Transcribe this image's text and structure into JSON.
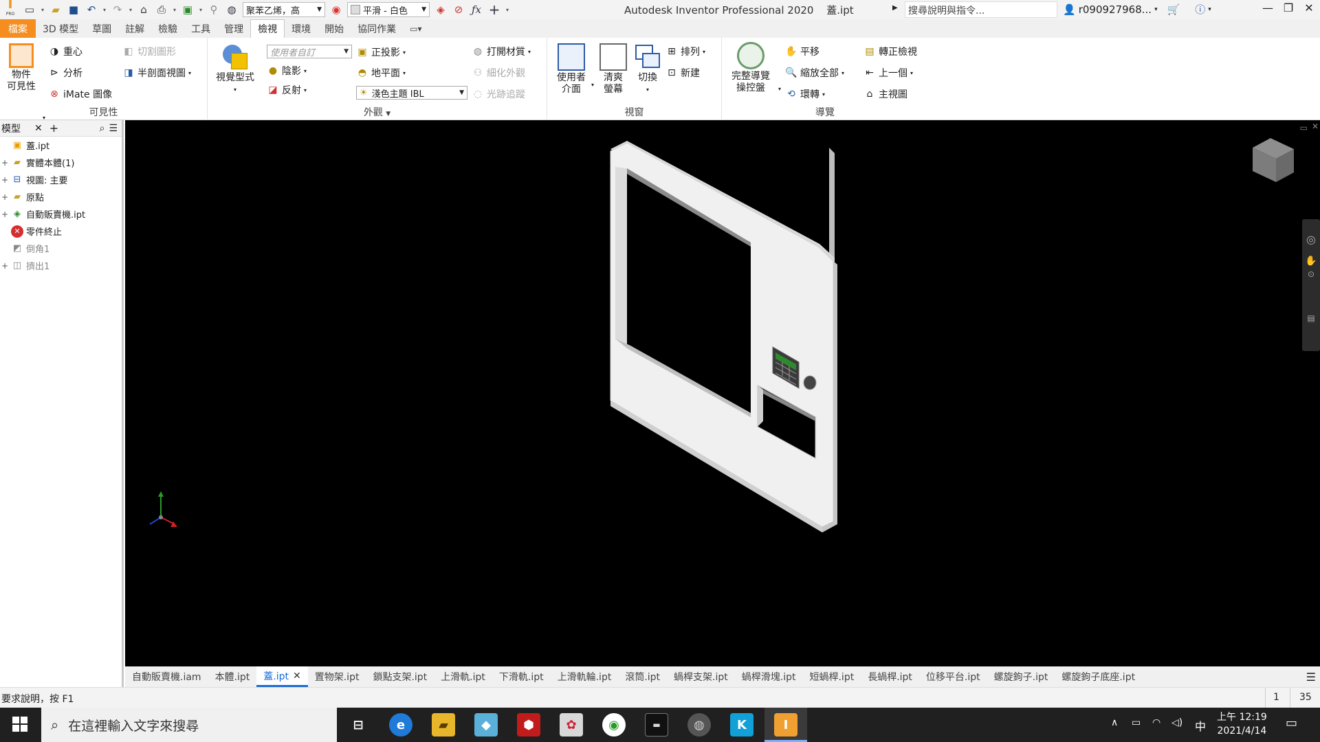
{
  "titlebar": {
    "app_title": "Autodesk Inventor Professional 2020",
    "doc_title": "蓋.ipt",
    "material_select": "聚苯乙烯，高",
    "appearance_select": "平滑 - 白色",
    "search_placeholder": "搜尋說明與指令...",
    "user_name": "r090927968...",
    "pro_label": "PRO"
  },
  "ribbon_tabs": [
    "檔案",
    "3D 模型",
    "草圖",
    "註解",
    "檢驗",
    "工具",
    "管理",
    "檢視",
    "環境",
    "開始",
    "協同作業"
  ],
  "ribbon_active_tab": "檢視",
  "ribbon": {
    "visibility": {
      "label": "可見性",
      "object_visibility": "物件\n可見性",
      "center_of_gravity": "重心",
      "analysis": "分析",
      "imate": "iMate 圖像",
      "slice_graphics": "切割圖形",
      "half_section": "半剖面視圖"
    },
    "appearance": {
      "label": "外觀",
      "visual_style": "視覺型式",
      "user_defined_combo": "使用者自訂",
      "shadows": "陰影",
      "reflections": "反射",
      "orthographic": "正投影",
      "ground_plane": "地平面",
      "ibl_combo": "淺色主題 IBL",
      "open_material": "打開材質",
      "refine_appearance": "細化外觀",
      "ray_tracing": "光跡追蹤"
    },
    "windows": {
      "label": "視窗",
      "user_interface": "使用者\n介面",
      "clean_screen": "清爽\n螢幕",
      "switch": "切換",
      "arrange": "排列",
      "new": "新建"
    },
    "navigate": {
      "label": "導覽",
      "full_nav_wheel": "完整導覽\n操控盤",
      "pan": "平移",
      "zoom_all": "縮放全部",
      "orbit": "環轉",
      "look_at": "轉正檢視",
      "previous": "上一個",
      "home_view": "主視圖"
    }
  },
  "browser": {
    "tab_label": "模型",
    "items": [
      {
        "label": "蓋.ipt"
      },
      {
        "label": "實體本體(1)"
      },
      {
        "label": "視圖: 主要"
      },
      {
        "label": "原點"
      },
      {
        "label": "自動販賣機.ipt"
      },
      {
        "label": "零件終止"
      },
      {
        "label": "倒角1"
      },
      {
        "label": "擠出1"
      }
    ]
  },
  "doc_tabs": [
    "自動販賣機.iam",
    "本體.ipt",
    "蓋.ipt",
    "置物架.ipt",
    "鎖點支架.ipt",
    "上滑軌.ipt",
    "下滑軌.ipt",
    "上滑軌輪.ipt",
    "滾筒.ipt",
    "蝸桿支架.ipt",
    "蝸桿滑塊.ipt",
    "短蝸桿.ipt",
    "長蝸桿.ipt",
    "位移平台.ipt",
    "螺旋鉤子.ipt",
    "螺旋鉤子底座.ipt"
  ],
  "doc_tab_active": "蓋.ipt",
  "statusbar": {
    "help_text": "要求說明，按 F1",
    "count1": "1",
    "count2": "35"
  },
  "taskbar": {
    "search_text": "在這裡輸入文字來搜尋",
    "time": "上午 12:19",
    "date": "2021/4/14",
    "ime": "中"
  },
  "colors": {
    "file_tab": "#f58d1f",
    "active_doc_tab": "#1a6ad8",
    "viewport_bg": "#000000",
    "model_face": "#f2f2f2"
  }
}
